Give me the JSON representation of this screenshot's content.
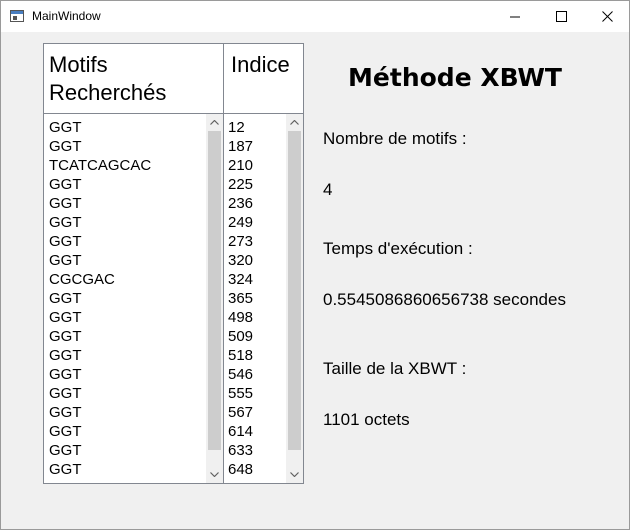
{
  "window": {
    "title": "MainWindow"
  },
  "motifs_list": {
    "header_line1": "Motifs",
    "header_line2": "Recherchés",
    "items": [
      "GGT",
      "GGT",
      "TCATCAGCAC",
      "GGT",
      "GGT",
      "GGT",
      "GGT",
      "GGT",
      "CGCGAC",
      "GGT",
      "GGT",
      "GGT",
      "GGT",
      "GGT",
      "GGT",
      "GGT",
      "GGT",
      "GGT",
      "GGT"
    ]
  },
  "indice_list": {
    "header": "Indice",
    "items": [
      "12",
      "187",
      "210",
      "225",
      "236",
      "249",
      "273",
      "320",
      "324",
      "365",
      "498",
      "509",
      "518",
      "546",
      "555",
      "567",
      "614",
      "633",
      "648"
    ]
  },
  "panel": {
    "heading": "Méthode XBWT",
    "count_label": "Nombre de motifs :",
    "count_value": "4",
    "time_label": "Temps d'exécution :",
    "time_value": "0.5545086860656738 secondes",
    "size_label": "Taille de la XBWT :",
    "size_value": "1101 octets"
  },
  "colors": {
    "window_bg": "#f0f0f0",
    "titlebar_bg": "#ffffff",
    "list_border": "#828790",
    "scroll_thumb": "#cdcdcd"
  }
}
